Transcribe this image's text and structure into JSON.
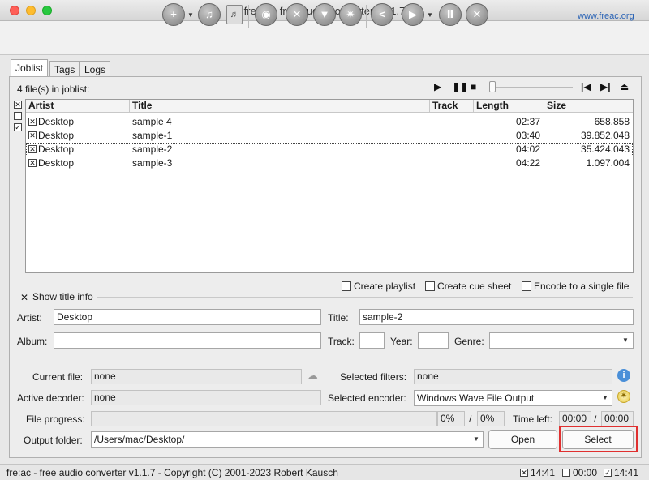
{
  "window": {
    "title": "fre:ac - free audio converter v1.1.7"
  },
  "toolbar": {
    "website": "www.freac.org"
  },
  "tabs": [
    {
      "label": "Joblist"
    },
    {
      "label": "Tags"
    },
    {
      "label": "Logs"
    }
  ],
  "joblist": {
    "count_text": "4 file(s) in joblist:",
    "columns": {
      "artist": "Artist",
      "title": "Title",
      "track": "Track",
      "length": "Length",
      "size": "Size"
    },
    "rows": [
      {
        "artist": "Desktop",
        "title": "sample 4",
        "track": "",
        "length": "02:37",
        "size": "658.858"
      },
      {
        "artist": "Desktop",
        "title": "sample-1",
        "track": "",
        "length": "03:40",
        "size": "39.852.048"
      },
      {
        "artist": "Desktop",
        "title": "sample-2",
        "track": "",
        "length": "04:02",
        "size": "35.424.043"
      },
      {
        "artist": "Desktop",
        "title": "sample-3",
        "track": "",
        "length": "04:22",
        "size": "1.097.004"
      }
    ]
  },
  "options": {
    "create_playlist": "Create playlist",
    "create_cue_sheet": "Create cue sheet",
    "encode_single_file": "Encode to a single file",
    "show_title_info": "Show title info"
  },
  "info": {
    "artist_label": "Artist:",
    "artist_value": "Desktop",
    "title_label": "Title:",
    "title_value": "sample-2",
    "album_label": "Album:",
    "album_value": "",
    "track_label": "Track:",
    "track_value": "",
    "year_label": "Year:",
    "year_value": "",
    "genre_label": "Genre:",
    "genre_value": ""
  },
  "status": {
    "current_file_label": "Current file:",
    "current_file_value": "none",
    "selected_filters_label": "Selected filters:",
    "selected_filters_value": "none",
    "active_decoder_label": "Active decoder:",
    "active_decoder_value": "none",
    "selected_encoder_label": "Selected encoder:",
    "selected_encoder_value": "Windows Wave File Output",
    "file_progress_label": "File progress:",
    "file_progress_pct": "0%",
    "total_sep": "/",
    "total_progress_pct": "0%",
    "time_left_label": "Time left:",
    "time_left_value": "00:00",
    "time_sep": "/",
    "time_total_value": "00:00",
    "output_folder_label": "Output folder:",
    "output_folder_value": "/Users/mac/Desktop/",
    "open_button": "Open",
    "select_button": "Select"
  },
  "statusbar": {
    "copyright": "fre:ac - free audio converter v1.1.7 - Copyright (C) 2001-2023 Robert Kausch",
    "time_selected": "14:41",
    "time_unselected": "00:00",
    "time_all": "14:41"
  },
  "colors": {
    "highlight": "#e03030",
    "link": "#2a63b5"
  }
}
